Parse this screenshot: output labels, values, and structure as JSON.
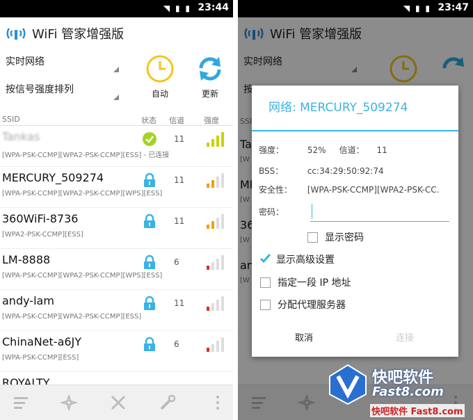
{
  "left": {
    "status_time": "23:44",
    "app_title": "WiFi 管家增强版",
    "spinner_network": "实时网络",
    "spinner_sort": "按信号强度排列",
    "auto_label": "自动",
    "refresh_label": "更新",
    "columns": {
      "ssid": "SSID",
      "status": "状态",
      "channel": "信道",
      "strength": "强度"
    },
    "rows": [
      {
        "ssid": "Tankas",
        "enc": "[WPA-PSK-CCMP][WPA2-PSK-CCMP][ESS] - 已连接",
        "channel": "11",
        "bars": 4,
        "connected": true
      },
      {
        "ssid": "MERCURY_509274",
        "enc": "[WPA-PSK-CCMP][WPA2-PSK-CCMP][WPS][ESS]",
        "channel": "11",
        "bars": 2,
        "connected": false
      },
      {
        "ssid": "360WiFi-8736",
        "enc": "[WPA2-PSK-CCMP][ESS]",
        "channel": "11",
        "bars": 2,
        "connected": false
      },
      {
        "ssid": "LM-8888",
        "enc": "[WPA-PSK-CCMP][WPA2-PSK-CCMP][WPS][ESS]",
        "channel": "6",
        "bars": 1,
        "connected": false
      },
      {
        "ssid": "andy-lam",
        "enc": "[WPA-PSK-CCMP][WPA2-PSK-CCMP][ESS]",
        "channel": "11",
        "bars": 1,
        "connected": false
      },
      {
        "ssid": "ChinaNet-a6JY",
        "enc": "[WPA-PSK-CCMP][ESS]",
        "channel": "6",
        "bars": 1,
        "connected": false
      },
      {
        "ssid": "ROYALTY",
        "enc": "",
        "channel": "",
        "bars": 0,
        "connected": false
      }
    ]
  },
  "right": {
    "status_time": "23:47",
    "app_title": "WiFi 管家增强版",
    "spinner_network": "实时网络",
    "spinner_sort_partial": "按",
    "bg_rows": [
      "Ta",
      "ME",
      "36",
      "an"
    ],
    "bg_enc": [
      "[W",
      "[W",
      "[W",
      "[W"
    ],
    "dialog": {
      "title": "网络: MERCURY_509274",
      "strength_label": "强度：",
      "strength_value": "52%",
      "channel_label": "信道：",
      "channel_value": "11",
      "bss_label": "BSS：",
      "bss_value": "cc:34:29:50:92:74",
      "security_label": "安全性：",
      "security_value": "[WPA-PSK-CCMP][WPA2-PSK-CC.",
      "password_label": "密码：",
      "show_password": "显示密码",
      "advanced": "显示高级设置",
      "static_ip": "指定一段 IP 地址",
      "proxy": "分配代理服务器",
      "cancel": "取消",
      "connect": "连接"
    },
    "watermark": {
      "name": "快吧软件",
      "sub": "Fast8.com",
      "bottom": "快吧软件 Fast8.com"
    }
  },
  "colors": {
    "accent": "#39b3e6",
    "yellow": "#f5c518",
    "green_check": "#a4d321",
    "signal_good": "#c8d400",
    "signal_mid": "#f0a000",
    "signal_bad": "#e03020"
  }
}
